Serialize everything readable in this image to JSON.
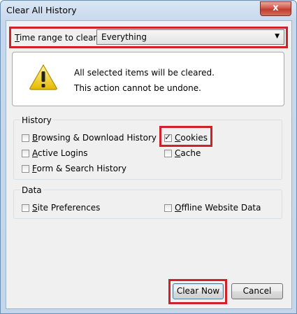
{
  "window": {
    "title": "Clear All History",
    "close_glyph": "x"
  },
  "time_range": {
    "label_underlined": "T",
    "label_rest": "ime range to clear:",
    "selected": "Everything"
  },
  "warning": {
    "icon": "warning-triangle-icon",
    "line1": "All selected items will be cleared.",
    "line2": "This action cannot be undone."
  },
  "history": {
    "title": "History",
    "items": [
      {
        "u": "B",
        "rest": "rowsing & Download History",
        "checked": false
      },
      {
        "u": "A",
        "rest": "ctive Logins",
        "checked": false
      },
      {
        "u": "F",
        "rest": "orm & Search History",
        "checked": false
      },
      {
        "u": "C",
        "rest": "ookies",
        "checked": true
      },
      {
        "u": "C",
        "rest": "ache",
        "checked": false
      }
    ]
  },
  "data": {
    "title": "Data",
    "items": [
      {
        "u": "S",
        "rest": "ite Preferences",
        "checked": false
      },
      {
        "u": "O",
        "rest": "ffline Website Data",
        "checked": false
      }
    ]
  },
  "buttons": {
    "clear_now": "Clear Now",
    "cancel": "Cancel"
  },
  "colors": {
    "highlight": "#d0202a",
    "accent": "#3c7fb1"
  }
}
